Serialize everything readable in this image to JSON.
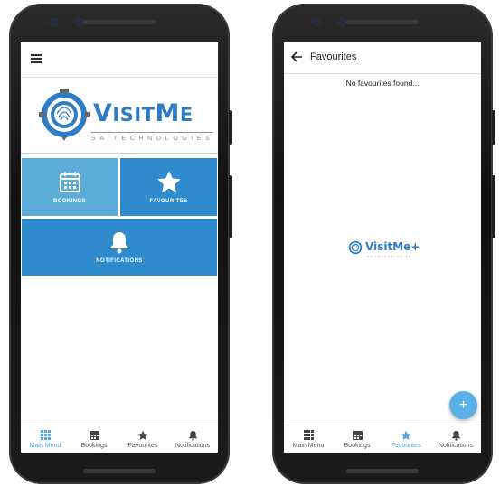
{
  "left_screen": {
    "logo": {
      "title_big": "V",
      "title_rest": "ISIT",
      "title_big2": "M",
      "title_rest2": "E",
      "subtitle": "SA TECHNOLOGIES"
    },
    "tiles": [
      {
        "label": "BOOKINGS",
        "icon": "calendar-icon"
      },
      {
        "label": "FAVOURITES",
        "icon": "star-icon"
      },
      {
        "label": "NOTIFICATIONS",
        "icon": "bell-icon"
      }
    ],
    "nav": [
      {
        "label": "Main Menu",
        "icon": "grid-icon",
        "active": true
      },
      {
        "label": "Bookings",
        "icon": "calendar-icon",
        "active": false
      },
      {
        "label": "Favourites",
        "icon": "star-icon",
        "active": false
      },
      {
        "label": "Notifications",
        "icon": "bell-icon",
        "active": false
      }
    ]
  },
  "right_screen": {
    "title": "Favourites",
    "empty_message": "No favourites found...",
    "center_logo": {
      "title": "VisitMe+",
      "subtitle": "SA TECHNOLOGIES"
    },
    "fab_label": "+",
    "nav": [
      {
        "label": "Main Menu",
        "icon": "grid-icon",
        "active": false
      },
      {
        "label": "Bookings",
        "icon": "calendar-icon",
        "active": false
      },
      {
        "label": "Favourites",
        "icon": "star-icon",
        "active": true
      },
      {
        "label": "Notifications",
        "icon": "bell-icon",
        "active": false
      }
    ]
  },
  "colors": {
    "accent": "#2f8bcc",
    "accent_light": "#5bacd8",
    "nav_active": "#4fa3e0"
  }
}
